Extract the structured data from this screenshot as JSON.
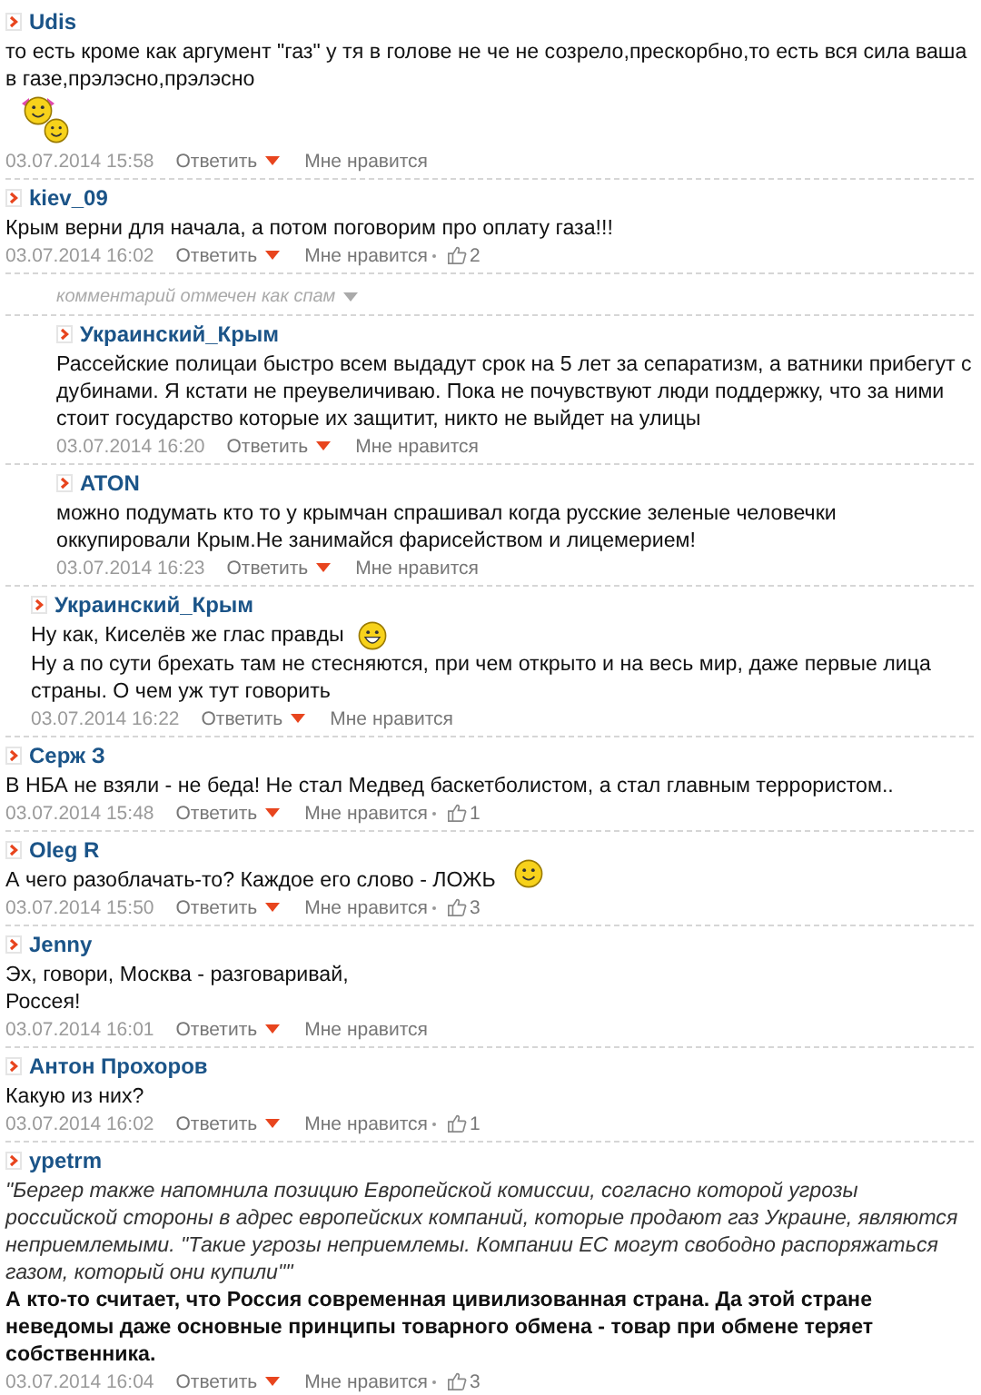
{
  "comments": [
    {
      "author": "Udis",
      "body": [
        {
          "kind": "text",
          "text": "то есть кроме как аргумент \"газ\" у тя в голове не че не созрело,прескорбно,то есть вся сила ваша в газе,прэлэсно,прэлэсно"
        },
        {
          "kind": "pair"
        }
      ],
      "time": "03.07.2014 15:58",
      "reply": "Ответить",
      "like": "Мне нравится"
    },
    {
      "author": "kiev_09",
      "body": [
        {
          "kind": "text",
          "text": "Крым верни для начала, а потом поговорим про оплату газа!!!"
        }
      ],
      "time": "03.07.2014 16:02",
      "reply": "Ответить",
      "like": "Мне нравится",
      "likes": "2",
      "children": [
        {
          "kind": "spam",
          "note": "комментарий отмечен как спам",
          "children": [
            {
              "author": "Украинский_Крым",
              "body": [
                {
                  "kind": "text",
                  "text": "Рассейские полицаи быстро всем выдадут срок на 5 лет за сепаратизм, а ватники прибегут с дубинами. Я кстати не преувеличиваю. Пока не почувствуют люди поддержку, что за ними стоит государство которые их защитит, никто не выйдет на улицы"
                }
              ],
              "time": "03.07.2014 16:20",
              "reply": "Ответить",
              "like": "Мне нравится"
            },
            {
              "author": "ATON",
              "body": [
                {
                  "kind": "text",
                  "text": "можно подумать кто то у крымчан спрашивал когда русские зеленые человечки оккупировали Крым.Не занимайся фарисейством и лицемерием!"
                }
              ],
              "time": "03.07.2014 16:23",
              "reply": "Ответить",
              "like": "Мне нравится"
            }
          ]
        },
        {
          "author": "Украинский_Крым",
          "body": [
            {
              "kind": "text",
              "text": "Ну как, Киселёв же глас правды "
            },
            {
              "kind": "grin"
            },
            {
              "kind": "text",
              "text": "Ну а по сути брехать там не стесняются, при чем открыто и на весь мир, даже первые лица страны. О чем уж тут говорить"
            }
          ],
          "time": "03.07.2014 16:22",
          "reply": "Ответить",
          "like": "Мне нравится"
        }
      ]
    },
    {
      "author": "Серж З",
      "body": [
        {
          "kind": "text",
          "text": "В НБА не взяли - не беда! Не стал Медвед баскетболистом, а стал главным террористом.."
        }
      ],
      "time": "03.07.2014 15:48",
      "reply": "Ответить",
      "like": "Мне нравится",
      "likes": "1"
    },
    {
      "author": "Oleg R",
      "body": [
        {
          "kind": "text",
          "text": "А чего разоблачать-то? Каждое его слово - ЛОЖЬ"
        },
        {
          "kind": "smile"
        }
      ],
      "time": "03.07.2014 15:50",
      "reply": "Ответить",
      "like": "Мне нравится",
      "likes": "3"
    },
    {
      "author": "Jenny",
      "body": [
        {
          "kind": "text",
          "text": "Эх, говори, Москва - разговаривай,\nРоссея!"
        }
      ],
      "time": "03.07.2014 16:01",
      "reply": "Ответить",
      "like": "Мне нравится"
    },
    {
      "author": "Антон Прохоров",
      "body": [
        {
          "kind": "text",
          "text": "Какую из них?"
        }
      ],
      "time": "03.07.2014 16:02",
      "reply": "Ответить",
      "like": "Мне нравится",
      "likes": "1"
    },
    {
      "author": "ypetrm",
      "body": [
        {
          "kind": "italic",
          "text": "\"Бергер также напомнила позицию Европейской комиссии, согласно которой угрозы российской стороны в адрес европейских компаний, которые продают газ Украине, являются неприемлемыми. \"Такие угрозы неприемлемы. Компании ЕС могут свободно распоряжаться газом, который они купили\"\""
        },
        {
          "kind": "bold",
          "text": "А кто-то считает, что Россия современная цивилизованная страна. Да этой стране неведомы даже основные принципы товарного обмена - товар при обмене теряет собственника."
        }
      ],
      "time": "03.07.2014 16:04",
      "reply": "Ответить",
      "like": "Мне нравится",
      "likes": "3"
    }
  ]
}
